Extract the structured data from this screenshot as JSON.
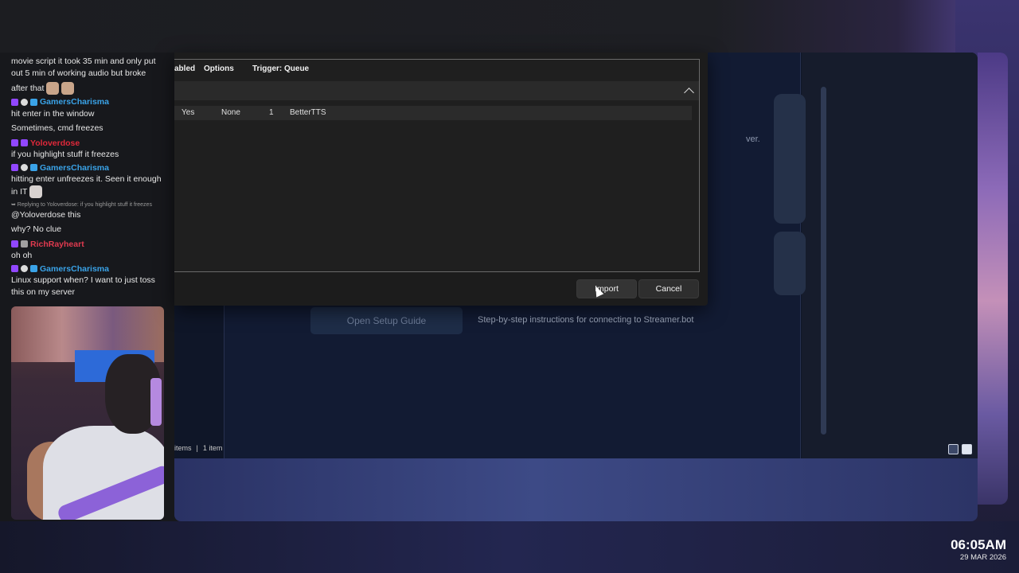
{
  "chat": {
    "lines": [
      {
        "text": "movie script it took 35 min and only put out 5 min of working audio but broke"
      },
      {
        "text": "after that"
      }
    ],
    "messages": [
      {
        "user": "GamersCharisma",
        "color": "blue",
        "text": "hit enter in the window"
      },
      {
        "text2": "Sometimes, cmd freezes"
      },
      {
        "user": "Yoloverdose",
        "color": "red",
        "text": "if you highlight stuff it freezes"
      },
      {
        "user": "GamersCharisma",
        "color": "blue",
        "text": "hitting enter unfreezes it. Seen it enough in IT"
      },
      {
        "reply": "➥ Replying to Yoloverdose: if you highlight stuff it freezes",
        "text": "@Yoloverdose this",
        "text2": "why? No clue"
      },
      {
        "user": "RichRayheart",
        "color": "pink",
        "text": "oh oh"
      },
      {
        "user": "GamersCharisma",
        "color": "blue",
        "text": "Linux support when? I want to just toss this on my server"
      }
    ]
  },
  "dialog": {
    "headers": {
      "enabled": "abled",
      "options": "Options",
      "trigger": "Trigger: Queue"
    },
    "row": {
      "enabled": "Yes",
      "options": "None",
      "queue": "1",
      "name": "BetterTTS"
    },
    "import_label": "Import",
    "cancel_label": "Cancel"
  },
  "app": {
    "setup_button": "Open Setup Guide",
    "setup_desc": "Step-by-step instructions for connecting to Streamer.bot",
    "card_text": "ver.",
    "status_items": "items",
    "status_selected": "1 item"
  },
  "clock": {
    "time": "06:05AM",
    "date": "29 MAR 2026"
  }
}
